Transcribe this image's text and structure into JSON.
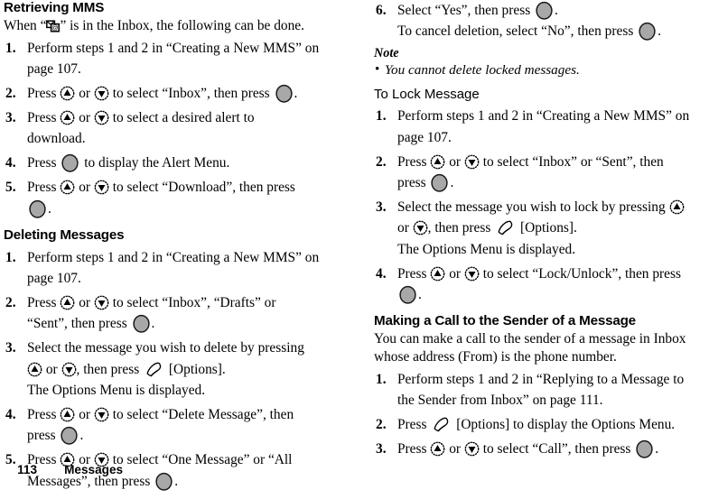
{
  "footer": {
    "page_number": "113",
    "section_title": "Messages"
  },
  "icons": {
    "nav_up": "nav-key-up-icon",
    "nav_down": "nav-key-down-icon",
    "center_select": "center-select-key-icon",
    "softkey_left": "left-softkey-icon",
    "mms_indicator": "mms-message-indicator-icon"
  },
  "left_column": {
    "heading_retrieving": "Retrieving MMS",
    "intro_retrieving_a": "When “",
    "intro_retrieving_b": "” is in the Inbox, the following can be done.",
    "steps_retrieving": [
      {
        "num": "1.",
        "a": "Perform steps 1 and 2 in “Creating a New MMS” on",
        "b": "page 107."
      },
      {
        "num": "2.",
        "a": "Press ",
        "b": " or ",
        "c": " to select “Inbox”, then press ",
        "d": "."
      },
      {
        "num": "3.",
        "a": "Press ",
        "b": " or ",
        "c": " to select a desired alert to",
        "d": "download."
      },
      {
        "num": "4.",
        "a": "Press ",
        "b": " to display the Alert Menu."
      },
      {
        "num": "5.",
        "a": "Press ",
        "b": " or ",
        "c": " to select “Download”, then press",
        "d": "."
      }
    ],
    "heading_deleting": "Deleting Messages",
    "steps_deleting": [
      {
        "num": "1.",
        "a": "Perform steps 1 and 2 in “Creating a New MMS” on",
        "b": "page 107."
      },
      {
        "num": "2.",
        "a": "Press ",
        "b": " or ",
        "c": " to select “Inbox”, “Drafts” or",
        "d": "“Sent”, then press ",
        "e": "."
      },
      {
        "num": "3.",
        "a": "Select the message you wish to delete by pressing",
        "b": " or ",
        "c": ", then press ",
        "d": " [Options].",
        "e": "The Options Menu is displayed."
      },
      {
        "num": "4.",
        "a": "Press ",
        "b": " or ",
        "c": " to select “Delete Message”, then",
        "d": "press ",
        "e": "."
      },
      {
        "num": "5.",
        "a": "Press ",
        "b": " or ",
        "c": " to select “One Message” or “All",
        "d": "Messages”, then press ",
        "e": "."
      }
    ]
  },
  "right_column": {
    "steps_deleting_cont": [
      {
        "num": "6.",
        "a": "Select “Yes”, then press ",
        "b": ".",
        "c": "To cancel deletion, select “No”, then press ",
        "d": "."
      }
    ],
    "note_heading": "Note",
    "note_items": [
      "You cannot delete locked messages."
    ],
    "heading_lock": "To Lock Message",
    "steps_lock": [
      {
        "num": "1.",
        "a": "Perform steps 1 and 2 in “Creating a New MMS” on",
        "b": "page 107."
      },
      {
        "num": "2.",
        "a": "Press ",
        "b": " or ",
        "c": " to select “Inbox” or “Sent”, then",
        "d": "press ",
        "e": "."
      },
      {
        "num": "3.",
        "a": "Select the message you wish to lock by pressing ",
        "b": "or ",
        "c": ", then press ",
        "d": " [Options].",
        "e": "The Options Menu is displayed."
      },
      {
        "num": "4.",
        "a": "Press ",
        "b": " or ",
        "c": " to select “Lock/Unlock”, then press",
        "d": "."
      }
    ],
    "heading_making_call": "Making a Call to the Sender of a Message",
    "intro_making_call_a": "You can make a call to the sender of a message in Inbox",
    "intro_making_call_b": "whose address (From) is the phone number.",
    "steps_making_call": [
      {
        "num": "1.",
        "a": "Perform steps 1 and 2 in “Replying to a Message to",
        "b": "the Sender from Inbox” on page 111."
      },
      {
        "num": "2.",
        "a": "Press ",
        "b": " [Options] to display the Options Menu."
      },
      {
        "num": "3.",
        "a": "Press ",
        "b": " or ",
        "c": " to select “Call”, then press ",
        "d": "."
      }
    ]
  }
}
